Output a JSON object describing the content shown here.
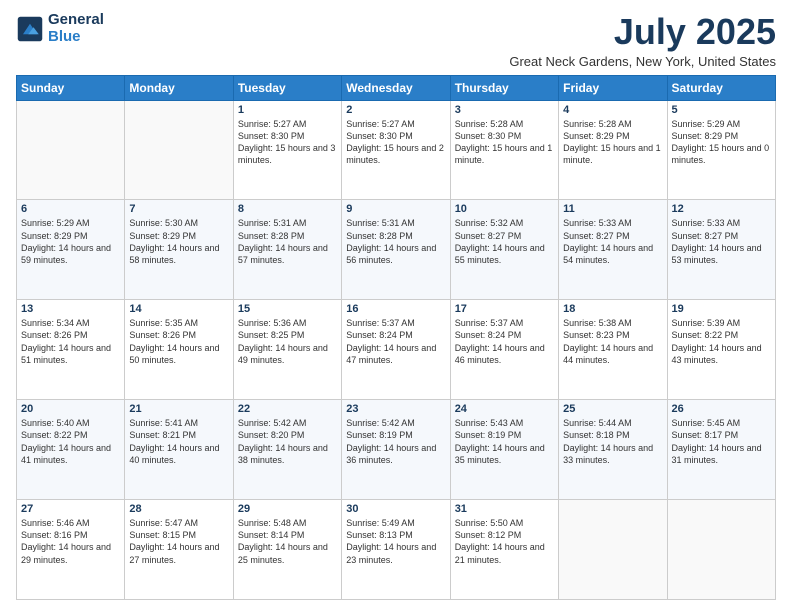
{
  "logo": {
    "general": "General",
    "blue": "Blue"
  },
  "header": {
    "title": "July 2025",
    "subtitle": "Great Neck Gardens, New York, United States"
  },
  "days_of_week": [
    "Sunday",
    "Monday",
    "Tuesday",
    "Wednesday",
    "Thursday",
    "Friday",
    "Saturday"
  ],
  "weeks": [
    [
      {
        "day": "",
        "sunrise": "",
        "sunset": "",
        "daylight": ""
      },
      {
        "day": "",
        "sunrise": "",
        "sunset": "",
        "daylight": ""
      },
      {
        "day": "1",
        "sunrise": "Sunrise: 5:27 AM",
        "sunset": "Sunset: 8:30 PM",
        "daylight": "Daylight: 15 hours and 3 minutes."
      },
      {
        "day": "2",
        "sunrise": "Sunrise: 5:27 AM",
        "sunset": "Sunset: 8:30 PM",
        "daylight": "Daylight: 15 hours and 2 minutes."
      },
      {
        "day": "3",
        "sunrise": "Sunrise: 5:28 AM",
        "sunset": "Sunset: 8:30 PM",
        "daylight": "Daylight: 15 hours and 1 minute."
      },
      {
        "day": "4",
        "sunrise": "Sunrise: 5:28 AM",
        "sunset": "Sunset: 8:29 PM",
        "daylight": "Daylight: 15 hours and 1 minute."
      },
      {
        "day": "5",
        "sunrise": "Sunrise: 5:29 AM",
        "sunset": "Sunset: 8:29 PM",
        "daylight": "Daylight: 15 hours and 0 minutes."
      }
    ],
    [
      {
        "day": "6",
        "sunrise": "Sunrise: 5:29 AM",
        "sunset": "Sunset: 8:29 PM",
        "daylight": "Daylight: 14 hours and 59 minutes."
      },
      {
        "day": "7",
        "sunrise": "Sunrise: 5:30 AM",
        "sunset": "Sunset: 8:29 PM",
        "daylight": "Daylight: 14 hours and 58 minutes."
      },
      {
        "day": "8",
        "sunrise": "Sunrise: 5:31 AM",
        "sunset": "Sunset: 8:28 PM",
        "daylight": "Daylight: 14 hours and 57 minutes."
      },
      {
        "day": "9",
        "sunrise": "Sunrise: 5:31 AM",
        "sunset": "Sunset: 8:28 PM",
        "daylight": "Daylight: 14 hours and 56 minutes."
      },
      {
        "day": "10",
        "sunrise": "Sunrise: 5:32 AM",
        "sunset": "Sunset: 8:27 PM",
        "daylight": "Daylight: 14 hours and 55 minutes."
      },
      {
        "day": "11",
        "sunrise": "Sunrise: 5:33 AM",
        "sunset": "Sunset: 8:27 PM",
        "daylight": "Daylight: 14 hours and 54 minutes."
      },
      {
        "day": "12",
        "sunrise": "Sunrise: 5:33 AM",
        "sunset": "Sunset: 8:27 PM",
        "daylight": "Daylight: 14 hours and 53 minutes."
      }
    ],
    [
      {
        "day": "13",
        "sunrise": "Sunrise: 5:34 AM",
        "sunset": "Sunset: 8:26 PM",
        "daylight": "Daylight: 14 hours and 51 minutes."
      },
      {
        "day": "14",
        "sunrise": "Sunrise: 5:35 AM",
        "sunset": "Sunset: 8:26 PM",
        "daylight": "Daylight: 14 hours and 50 minutes."
      },
      {
        "day": "15",
        "sunrise": "Sunrise: 5:36 AM",
        "sunset": "Sunset: 8:25 PM",
        "daylight": "Daylight: 14 hours and 49 minutes."
      },
      {
        "day": "16",
        "sunrise": "Sunrise: 5:37 AM",
        "sunset": "Sunset: 8:24 PM",
        "daylight": "Daylight: 14 hours and 47 minutes."
      },
      {
        "day": "17",
        "sunrise": "Sunrise: 5:37 AM",
        "sunset": "Sunset: 8:24 PM",
        "daylight": "Daylight: 14 hours and 46 minutes."
      },
      {
        "day": "18",
        "sunrise": "Sunrise: 5:38 AM",
        "sunset": "Sunset: 8:23 PM",
        "daylight": "Daylight: 14 hours and 44 minutes."
      },
      {
        "day": "19",
        "sunrise": "Sunrise: 5:39 AM",
        "sunset": "Sunset: 8:22 PM",
        "daylight": "Daylight: 14 hours and 43 minutes."
      }
    ],
    [
      {
        "day": "20",
        "sunrise": "Sunrise: 5:40 AM",
        "sunset": "Sunset: 8:22 PM",
        "daylight": "Daylight: 14 hours and 41 minutes."
      },
      {
        "day": "21",
        "sunrise": "Sunrise: 5:41 AM",
        "sunset": "Sunset: 8:21 PM",
        "daylight": "Daylight: 14 hours and 40 minutes."
      },
      {
        "day": "22",
        "sunrise": "Sunrise: 5:42 AM",
        "sunset": "Sunset: 8:20 PM",
        "daylight": "Daylight: 14 hours and 38 minutes."
      },
      {
        "day": "23",
        "sunrise": "Sunrise: 5:42 AM",
        "sunset": "Sunset: 8:19 PM",
        "daylight": "Daylight: 14 hours and 36 minutes."
      },
      {
        "day": "24",
        "sunrise": "Sunrise: 5:43 AM",
        "sunset": "Sunset: 8:19 PM",
        "daylight": "Daylight: 14 hours and 35 minutes."
      },
      {
        "day": "25",
        "sunrise": "Sunrise: 5:44 AM",
        "sunset": "Sunset: 8:18 PM",
        "daylight": "Daylight: 14 hours and 33 minutes."
      },
      {
        "day": "26",
        "sunrise": "Sunrise: 5:45 AM",
        "sunset": "Sunset: 8:17 PM",
        "daylight": "Daylight: 14 hours and 31 minutes."
      }
    ],
    [
      {
        "day": "27",
        "sunrise": "Sunrise: 5:46 AM",
        "sunset": "Sunset: 8:16 PM",
        "daylight": "Daylight: 14 hours and 29 minutes."
      },
      {
        "day": "28",
        "sunrise": "Sunrise: 5:47 AM",
        "sunset": "Sunset: 8:15 PM",
        "daylight": "Daylight: 14 hours and 27 minutes."
      },
      {
        "day": "29",
        "sunrise": "Sunrise: 5:48 AM",
        "sunset": "Sunset: 8:14 PM",
        "daylight": "Daylight: 14 hours and 25 minutes."
      },
      {
        "day": "30",
        "sunrise": "Sunrise: 5:49 AM",
        "sunset": "Sunset: 8:13 PM",
        "daylight": "Daylight: 14 hours and 23 minutes."
      },
      {
        "day": "31",
        "sunrise": "Sunrise: 5:50 AM",
        "sunset": "Sunset: 8:12 PM",
        "daylight": "Daylight: 14 hours and 21 minutes."
      },
      {
        "day": "",
        "sunrise": "",
        "sunset": "",
        "daylight": ""
      },
      {
        "day": "",
        "sunrise": "",
        "sunset": "",
        "daylight": ""
      }
    ]
  ]
}
